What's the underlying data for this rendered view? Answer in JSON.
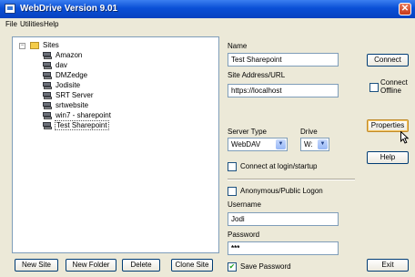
{
  "window": {
    "title": "WebDrive Version 9.01"
  },
  "menu": [
    "File",
    "Utilities",
    "Help"
  ],
  "tree": {
    "root_label": "Sites",
    "items": [
      "Amazon",
      "dav",
      "DMZedge",
      "Jodisite",
      "SRT Server",
      "srtwebsite",
      "win7 - sharepoint",
      "Test Sharepoint"
    ],
    "selected": "Test Sharepoint"
  },
  "bottom_buttons": {
    "new_site": "New Site",
    "new_folder": "New Folder",
    "delete": "Delete",
    "clone_site": "Clone Site"
  },
  "form": {
    "name_label": "Name",
    "name_value": "Test Sharepoint",
    "url_label": "Site Address/URL",
    "url_value": "https://localhost",
    "server_type_label": "Server Type",
    "server_type_value": "WebDAV",
    "drive_label": "Drive",
    "drive_value": "W:",
    "connect_at_login_label": "Connect at login/startup",
    "connect_at_login_checked": false,
    "anonymous_label": "Anonymous/Public Logon",
    "anonymous_checked": false,
    "username_label": "Username",
    "username_value": "Jodi",
    "password_label": "Password",
    "password_value": "***",
    "save_password_label": "Save Password",
    "save_password_checked": true
  },
  "right_buttons": {
    "connect": "Connect",
    "connect_offline": "Connect Offline",
    "properties": "Properties",
    "help": "Help",
    "exit": "Exit"
  }
}
